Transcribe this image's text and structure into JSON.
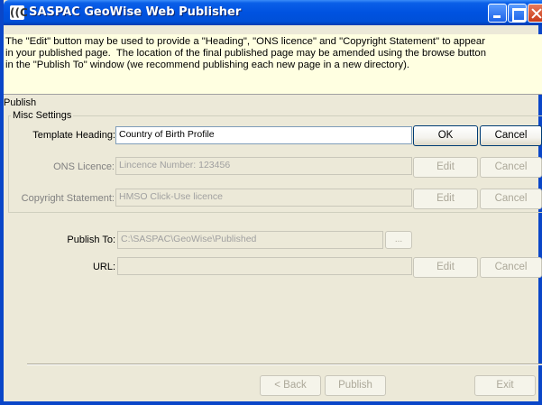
{
  "window": {
    "title": "SASPAC GeoWise Web Publisher",
    "icon_glyph": "((C",
    "title_bar_color": "#0054e3"
  },
  "info_text": "The \"Edit\" button may be used to provide a \"Heading\", \"ONS licence\" and \"Copyright Statement\" to appear\nin your published page.  The location of the final published page may be amended using the browse button\nin the \"Publish To\" window (we recommend publishing each new page in a new directory).",
  "publish_label": "Publish",
  "misc_settings": {
    "legend": "Misc Settings",
    "template_heading": {
      "label": "Template Heading:",
      "value": "Country of Birth Profile",
      "ok": "OK",
      "cancel": "Cancel"
    },
    "ons_licence": {
      "label": "ONS Licence:",
      "value": "Lincence Number: 123456",
      "edit": "Edit",
      "cancel": "Cancel"
    },
    "copyright": {
      "label": "Copyright Statement:",
      "value": "HMSO Click-Use licence",
      "edit": "Edit",
      "cancel": "Cancel"
    }
  },
  "publish_to": {
    "label": "Publish To:",
    "value": "C:\\SASPAC\\GeoWise\\Published",
    "browse": "..."
  },
  "url": {
    "label": "URL:",
    "value": "",
    "edit": "Edit",
    "cancel": "Cancel"
  },
  "footer": {
    "back": "< Back",
    "publish": "Publish",
    "exit": "Exit"
  }
}
